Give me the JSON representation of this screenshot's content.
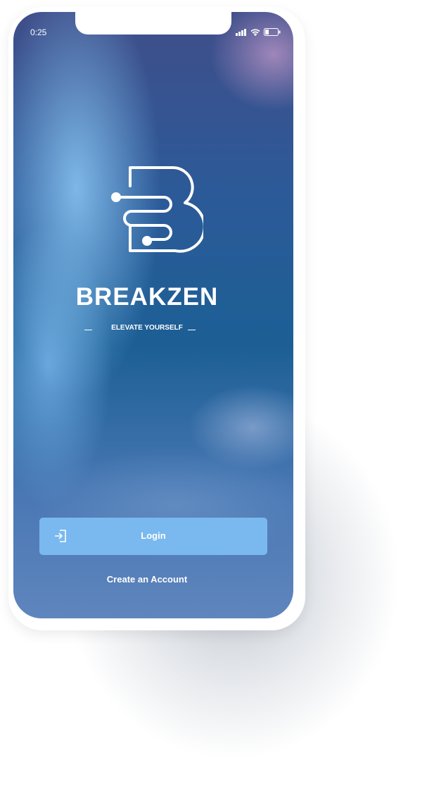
{
  "status_bar": {
    "time": "0:25"
  },
  "app": {
    "name": "BREAKZEN",
    "tagline": "ELEVATE YOURSELF"
  },
  "actions": {
    "login_label": "Login",
    "create_account_label": "Create an Account"
  },
  "colors": {
    "login_button": "#7ab9ef"
  }
}
